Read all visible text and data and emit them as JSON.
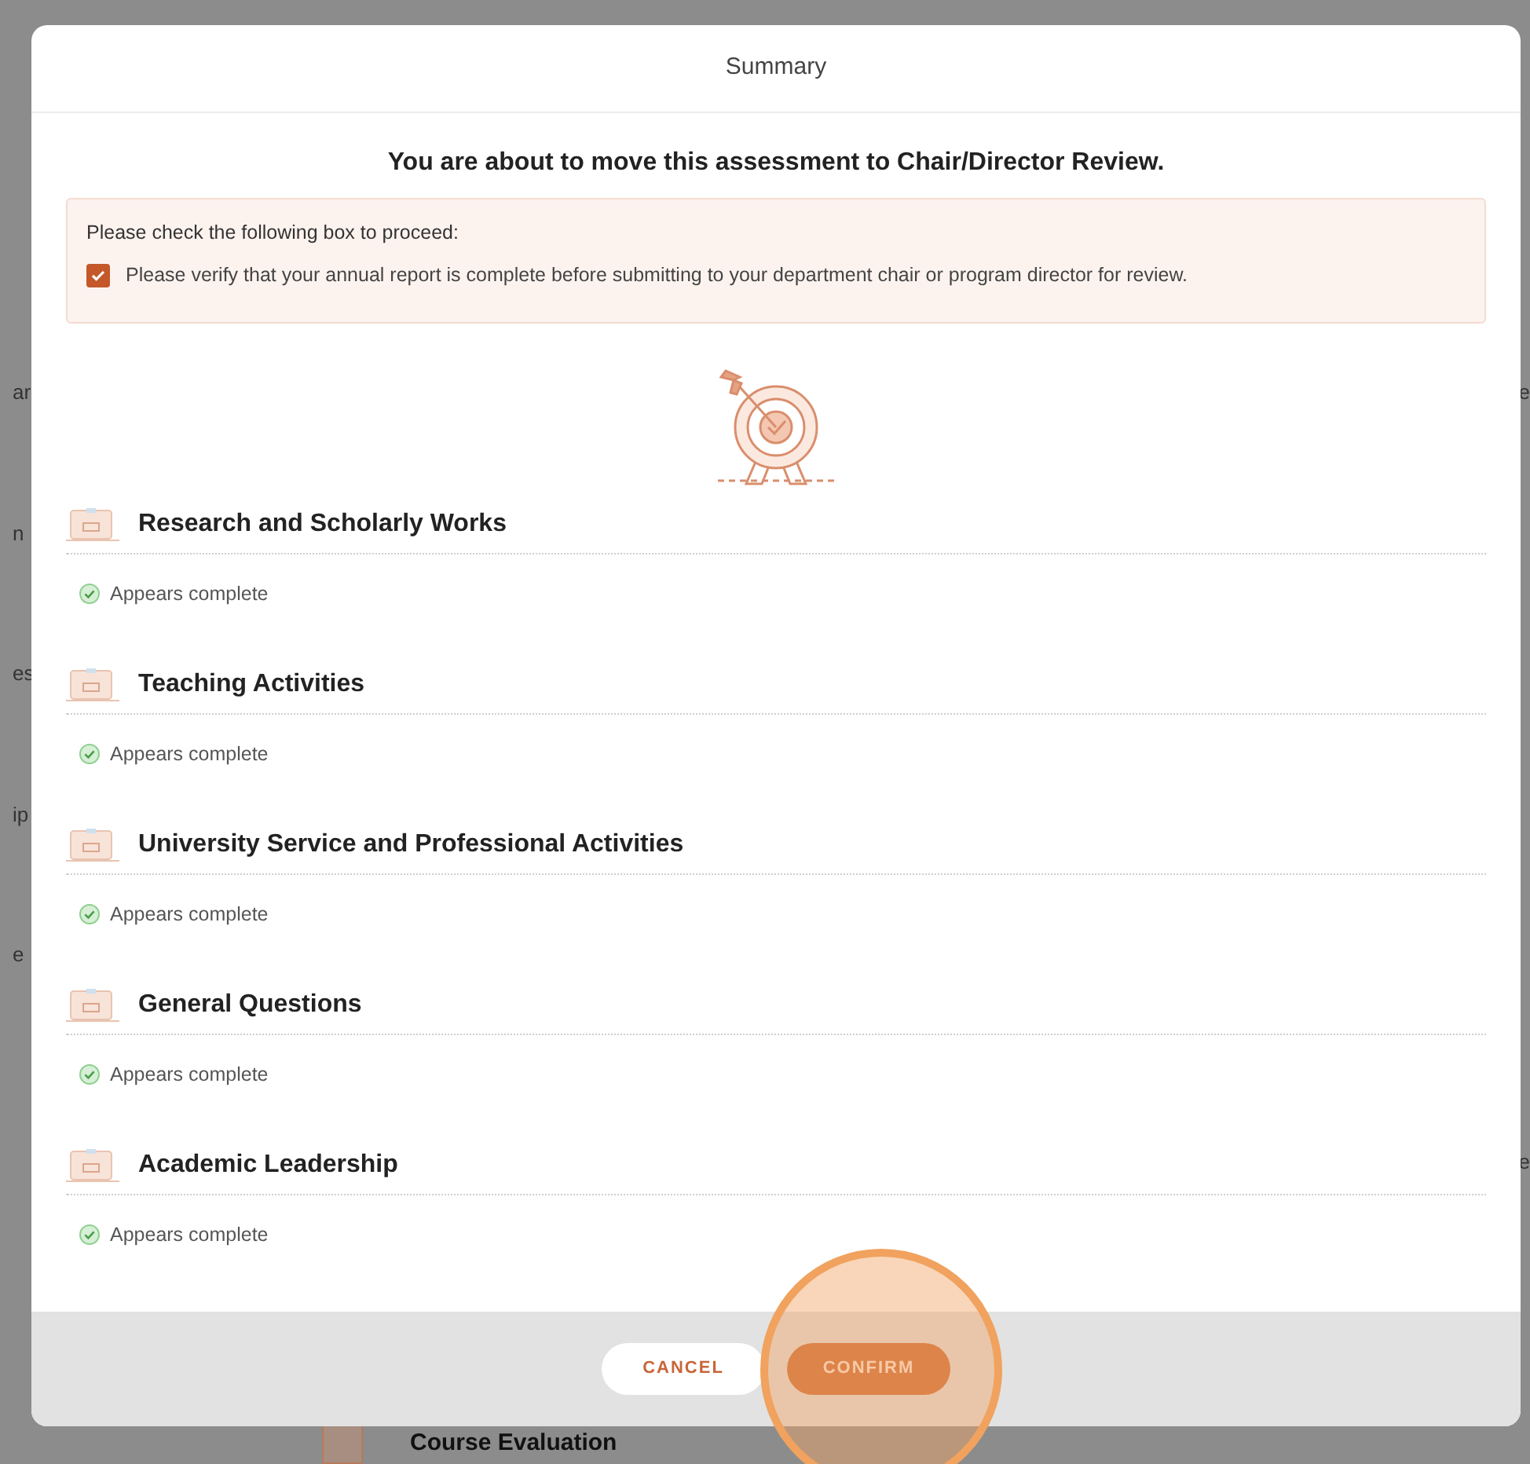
{
  "background": {
    "left_fragments": [
      "ar",
      "n",
      "es",
      "ip",
      "e"
    ],
    "right_fragments": [
      "e",
      "e"
    ],
    "bottom_item": "Course Evaluation"
  },
  "dialog": {
    "title": "Summary",
    "heading": "You are about to move this assessment to Chair/Director Review.",
    "notice": {
      "prompt": "Please check the following box to proceed:",
      "checkbox": {
        "label": "Please verify that your annual report is complete before submitting to your department chair or program director for review.",
        "checked": true
      }
    },
    "sections": [
      {
        "title": "Research and Scholarly Works",
        "status": "Appears complete"
      },
      {
        "title": "Teaching Activities",
        "status": "Appears complete"
      },
      {
        "title": "University Service and Professional Activities",
        "status": "Appears complete"
      },
      {
        "title": "General Questions",
        "status": "Appears complete"
      },
      {
        "title": "Academic Leadership",
        "status": "Appears complete"
      }
    ],
    "buttons": [
      {
        "label": "CANCEL",
        "kind": "secondary"
      },
      {
        "label": "CONFIRM",
        "kind": "primary"
      }
    ]
  }
}
